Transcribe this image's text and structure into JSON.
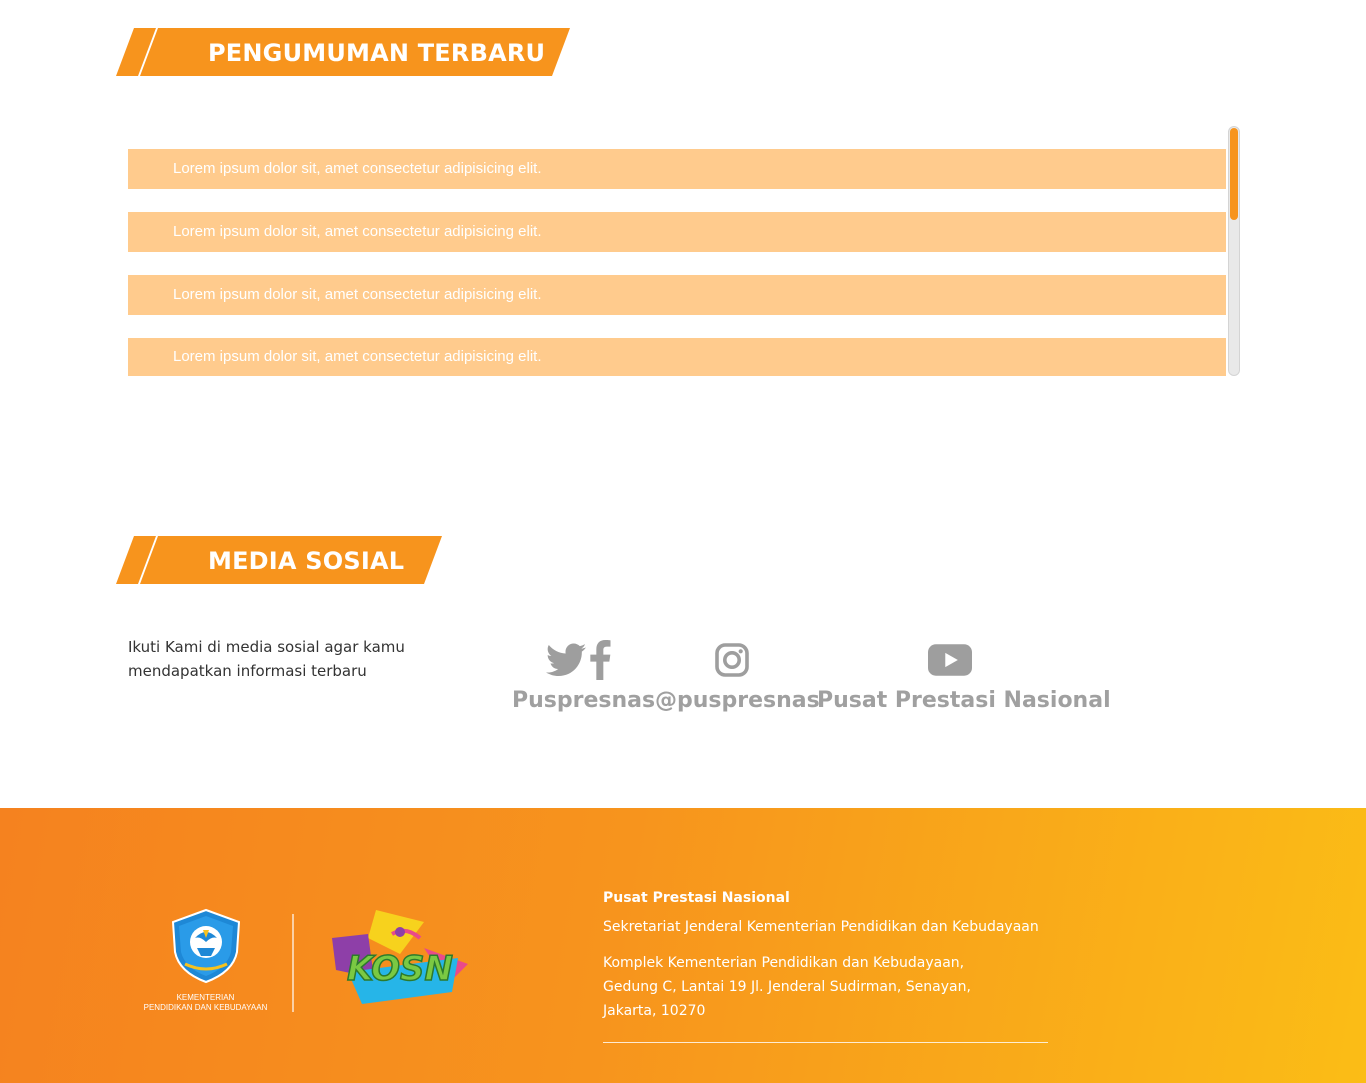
{
  "announcements": {
    "title": "PENGUMUMAN TERBARU",
    "items": [
      "Lorem ipsum dolor sit, amet consectetur adipisicing elit.",
      "Lorem ipsum dolor sit, amet consectetur adipisicing elit.",
      "Lorem ipsum dolor sit, amet consectetur adipisicing elit.",
      "Lorem ipsum dolor sit, amet consectetur adipisicing elit."
    ]
  },
  "social": {
    "title": "MEDIA SOSIAL",
    "description": "Ikuti Kami di media sosial agar kamu mendapatkan informasi terbaru",
    "accounts": [
      {
        "icons": [
          "twitter-icon",
          "facebook-icon"
        ],
        "label": "Puspresnas"
      },
      {
        "icons": [
          "instagram-icon"
        ],
        "label": "@puspresnas"
      },
      {
        "icons": [
          "youtube-icon"
        ],
        "label": "Pusat Prestasi Nasional"
      }
    ]
  },
  "footer": {
    "logo_caption_1": "KEMENTERIAN",
    "logo_caption_2": "PENDIDIKAN DAN KEBUDAYAAN",
    "kosn_text": "KOSN",
    "org_name": "Pusat Prestasi Nasional",
    "sub_org": "Sekretariat Jenderal Kementerian Pendidikan dan Kebudayaan",
    "address_1": "Komplek Kementerian Pendidikan dan Kebudayaan,",
    "address_2": "Gedung C, Lantai 19 Jl. Jenderal Sudirman, Senayan,",
    "address_3": "Jakarta, 10270"
  },
  "colors": {
    "accent": "#f7941d",
    "item_bg": "#ffcb8d",
    "icon_gray": "#9e9e9e"
  }
}
